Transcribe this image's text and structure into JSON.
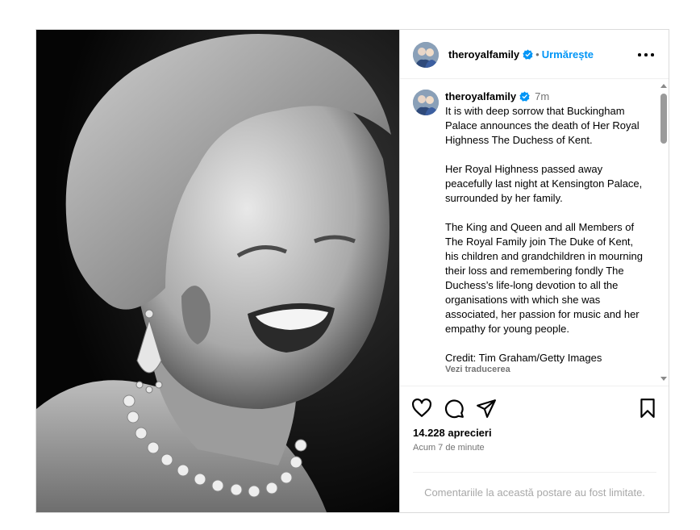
{
  "post": {
    "username": "theroyalfamily",
    "follow_label": "Urmărește",
    "dot": "•",
    "verified_icon": "verified-badge-icon",
    "more_icon": "more-options-icon",
    "caption": {
      "username": "theroyalfamily",
      "time": "7m",
      "text": "It is with deep sorrow that Buckingham Palace announces the death of Her Royal Highness The Duchess of Kent.\n\nHer Royal Highness passed away peacefully last night at Kensington Palace, surrounded by her family.\n\nThe King and Queen and all Members of The Royal Family join The Duke of Kent, his children and grandchildren in mourning their loss and remembering fondly The Duchess’s life-long devotion to all the organisations with which she was associated, her passion for music and her empathy for young people.\n\nCredit: Tim Graham/Getty Images",
      "translate_label": "Vezi traducerea"
    },
    "actions": {
      "like_icon": "heart-icon",
      "comment_icon": "comment-icon",
      "share_icon": "send-icon",
      "save_icon": "bookmark-icon"
    },
    "likes": "14.228 aprecieri",
    "time_ago": "Acum 7 de minute",
    "comments_limited": "Comentariile la această postare au fost limitate."
  },
  "colors": {
    "accent": "#0095f6",
    "verified": "#0095f6",
    "muted": "#737373",
    "border": "#dbdbdb"
  }
}
